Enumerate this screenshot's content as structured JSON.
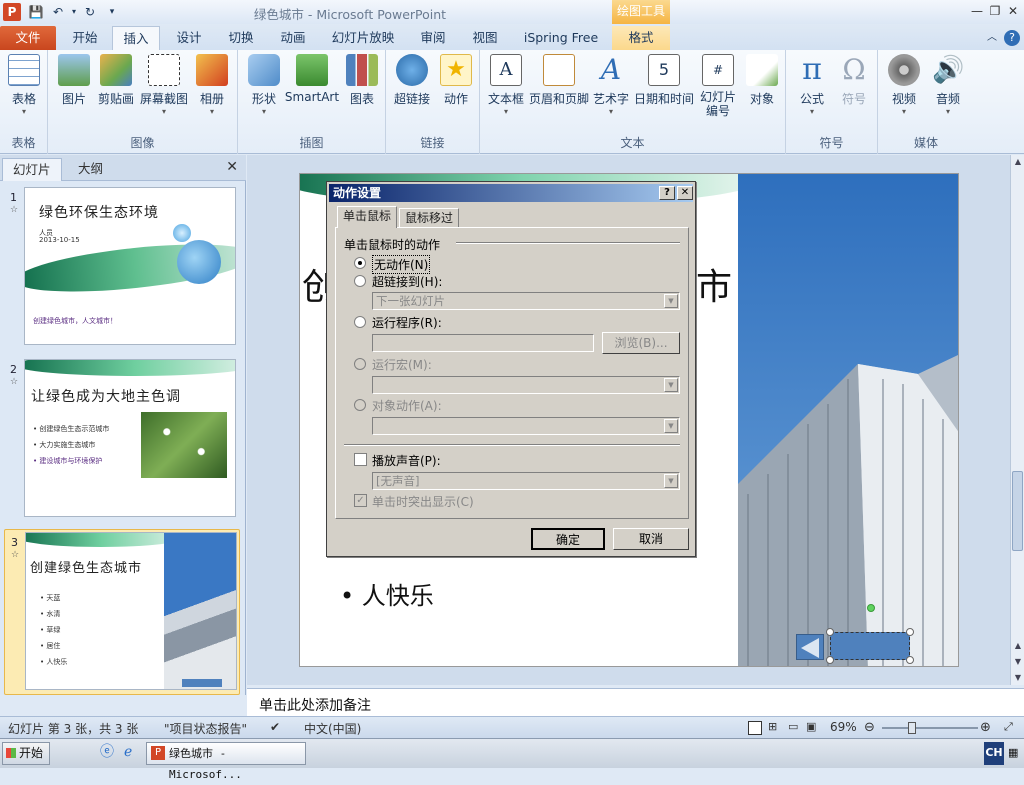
{
  "window": {
    "app_icon": "P",
    "title": "绿色城市 - Microsoft PowerPoint",
    "context_tab_group": "绘图工具"
  },
  "ribbon_tabs": [
    "文件",
    "开始",
    "插入",
    "设计",
    "切换",
    "动画",
    "幻灯片放映",
    "审阅",
    "视图",
    "iSpring Free",
    "格式"
  ],
  "ribbon": {
    "groups": {
      "tables": "表格",
      "images": "图像",
      "illustrations": "插图",
      "links": "链接",
      "text": "文本",
      "symbols": "符号",
      "media": "媒体"
    },
    "buttons": {
      "table": "表格",
      "picture": "图片",
      "clipart": "剪贴画",
      "screenshot": "屏幕截图",
      "album": "相册",
      "shapes": "形状",
      "smartart": "SmartArt",
      "chart": "图表",
      "hyperlink": "超链接",
      "action": "动作",
      "textbox": "文本框",
      "header_footer": "页眉和页脚",
      "wordart": "艺术字",
      "datetime": "日期和时间",
      "slide_number": "幻灯片\n编号",
      "object": "对象",
      "equation": "公式",
      "symbol": "符号",
      "video": "视频",
      "audio": "音频"
    }
  },
  "left_pane": {
    "tabs": [
      "幻灯片",
      "大纲"
    ],
    "slides": [
      {
        "num": "1",
        "title": "绿色环保生态环境",
        "lines": [
          "人员",
          "2013-10-15",
          "创建绿色城市，人文城市！"
        ]
      },
      {
        "num": "2",
        "title": "让绿色成为大地主色调",
        "lines": [
          "创建绿色生态示范城市",
          "大力实施生态城市",
          "建设城市与环境保护"
        ]
      },
      {
        "num": "3",
        "title": "创建绿色生态城市",
        "lines": [
          "天蓝",
          "水清",
          "草绿",
          "居住",
          "人快乐"
        ]
      }
    ]
  },
  "slide": {
    "title_fragment_left": "创",
    "title_fragment_right": "市",
    "bullet": "人快乐"
  },
  "notes_placeholder": "单击此处添加备注",
  "statusbar": {
    "slide_info": "幻灯片 第 3 张，共 3 张",
    "theme": "\"项目状态报告\"",
    "language": "中文(中国)",
    "zoom": "69%"
  },
  "taskbar": {
    "start": "开始",
    "window_button": "绿色城市 - Microsof...",
    "ime": "CH"
  },
  "dialog": {
    "title": "动作设置",
    "help": "?",
    "close": "✕",
    "tabs": [
      "单击鼠标",
      "鼠标移过"
    ],
    "section_label": "单击鼠标时的动作",
    "options": {
      "none": "无动作(N)",
      "hyperlink": "超链接到(H):",
      "hyperlink_target": "下一张幻灯片",
      "run_program": "运行程序(R):",
      "run_program_value": "",
      "browse": "浏览(B)...",
      "run_macro": "运行宏(M):",
      "object_action": "对象动作(A):",
      "play_sound": "播放声音(P):",
      "sound_value": "[无声音]",
      "highlight": "单击时突出显示(C)"
    },
    "ok": "确定",
    "cancel": "取消"
  }
}
